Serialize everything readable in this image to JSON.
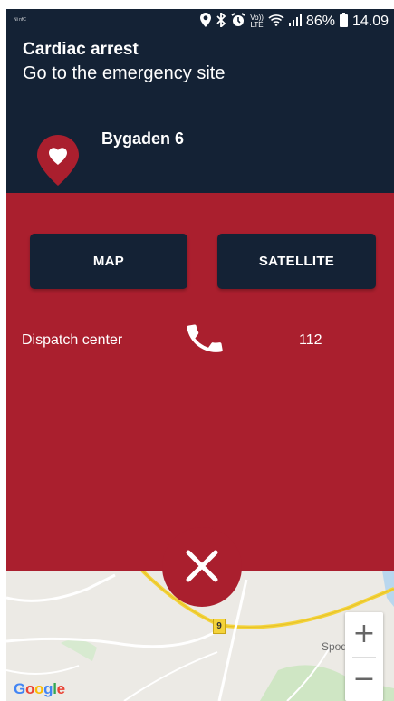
{
  "status_bar": {
    "left_text": "Ni nfC",
    "lte_top": "Vo))",
    "lte_bottom": "LTE",
    "battery": "86%",
    "time": "14.09",
    "icons": [
      "location-icon",
      "bluetooth-icon",
      "alarm-icon",
      "volte-icon",
      "wifi-icon",
      "signal-icon",
      "battery-icon"
    ]
  },
  "alert": {
    "title": "Cardiac arrest",
    "subtitle": "Go to the emergency site",
    "address": "Bygaden 6"
  },
  "buttons": {
    "map": "MAP",
    "satellite": "SATELLITE"
  },
  "dispatch": {
    "label": "Dispatch center",
    "number": "112"
  },
  "map": {
    "road_number": "9",
    "town": "Spodsbjerg",
    "provider": "Google",
    "zoom_in": "+",
    "zoom_out": "−"
  },
  "colors": {
    "header_bg": "#142235",
    "panel_bg": "#aa1f2e",
    "button_bg": "#142235",
    "map_bg": "#eceae5"
  }
}
